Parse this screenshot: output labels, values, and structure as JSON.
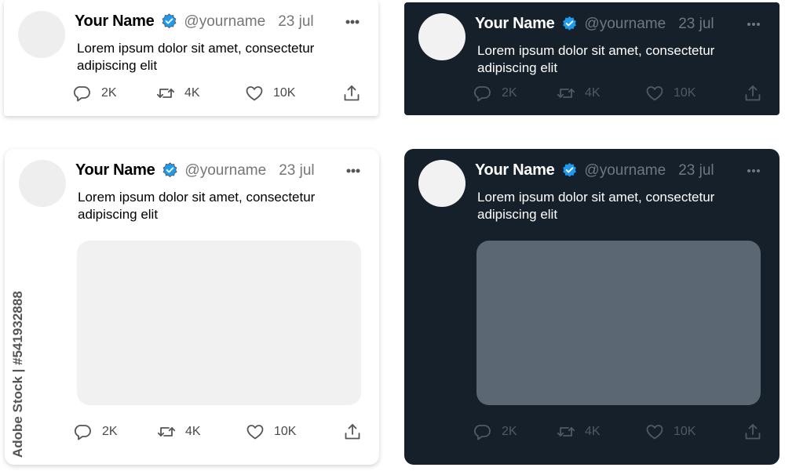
{
  "tweets": [
    {
      "name": "Your Name",
      "handle": "@yourname",
      "date": "23 jul",
      "text": "Lorem ipsum dolor sit amet, consectetur adipiscing elit",
      "replies": "2K",
      "retweets": "4K",
      "likes": "10K",
      "theme": "light",
      "has_media": false
    },
    {
      "name": "Your Name",
      "handle": "@yourname",
      "date": "23 jul",
      "text": "Lorem ipsum dolor sit amet, consectetur adipiscing elit",
      "replies": "2K",
      "retweets": "4K",
      "likes": "10K",
      "theme": "dark",
      "has_media": false
    },
    {
      "name": "Your Name",
      "handle": "@yourname",
      "date": "23 jul",
      "text": "Lorem ipsum dolor sit amet, consectetur adipiscing elit",
      "replies": "2K",
      "retweets": "4K",
      "likes": "10K",
      "theme": "light",
      "has_media": true
    },
    {
      "name": "Your Name",
      "handle": "@yourname",
      "date": "23 jul",
      "text": "Lorem ipsum dolor sit amet, consectetur adipiscing elit",
      "replies": "2K",
      "retweets": "4K",
      "likes": "10K",
      "theme": "dark",
      "has_media": true
    }
  ],
  "icons": {
    "verified": "verified-badge-icon",
    "more": "more-horizontal-icon",
    "reply": "reply-icon",
    "retweet": "retweet-icon",
    "like": "heart-icon",
    "share": "share-icon"
  },
  "colors": {
    "dark_background": "#15202b",
    "verified_blue": "#1d9bf0",
    "light_media": "#f1f1f1",
    "dark_media": "#5b6773"
  },
  "watermark": {
    "stock_id": "Adobe Stock | #541932888"
  }
}
